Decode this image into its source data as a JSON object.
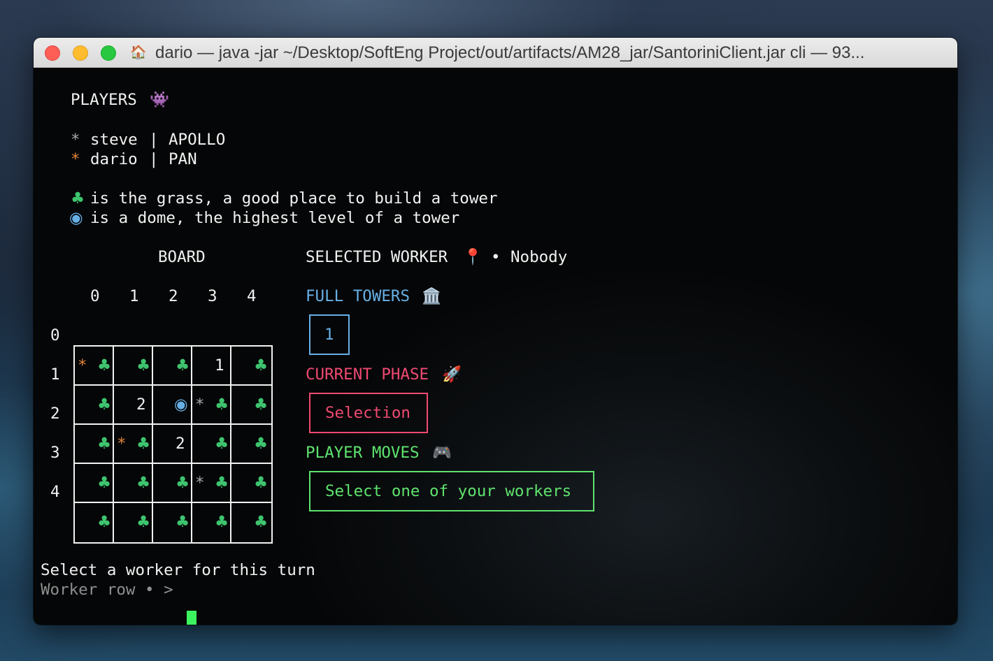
{
  "window": {
    "title": "dario — java -jar ~/Desktop/SoftEng Project/out/artifacts/AM28_jar/SantoriniClient.jar cli — 93...",
    "icon": "home-icon"
  },
  "players": {
    "heading": "PLAYERS",
    "heading_icon": "👾",
    "list": [
      {
        "marker": "*",
        "name": "steve",
        "sep": "|",
        "god": "APOLLO",
        "color": "#a9a9a9"
      },
      {
        "marker": "*",
        "name": "dario",
        "sep": "|",
        "god": "PAN",
        "color": "#e0843a"
      }
    ]
  },
  "legend": [
    {
      "symbol": "♣",
      "text": "is the grass, a good place to build a tower",
      "color": "#3ec46f"
    },
    {
      "symbol": "◉",
      "text": "is a dome, the highest level of a tower",
      "color": "#67b0e6"
    }
  ],
  "board": {
    "title": "BOARD",
    "col_headers": [
      "0",
      "1",
      "2",
      "3",
      "4"
    ],
    "row_headers": [
      "0",
      "1",
      "2",
      "3",
      "4"
    ],
    "rows": [
      [
        {
          "worker": "orange",
          "level": "",
          "dome": false,
          "grass": true
        },
        {
          "worker": "",
          "level": "",
          "dome": false,
          "grass": true
        },
        {
          "worker": "",
          "level": "",
          "dome": false,
          "grass": true
        },
        {
          "worker": "",
          "level": "1",
          "dome": false,
          "grass": false
        },
        {
          "worker": "",
          "level": "",
          "dome": false,
          "grass": true
        }
      ],
      [
        {
          "worker": "",
          "level": "",
          "dome": false,
          "grass": true
        },
        {
          "worker": "",
          "level": "2",
          "dome": false,
          "grass": false
        },
        {
          "worker": "",
          "level": "",
          "dome": true,
          "grass": false
        },
        {
          "worker": "grey",
          "level": "",
          "dome": false,
          "grass": true
        },
        {
          "worker": "",
          "level": "",
          "dome": false,
          "grass": true
        }
      ],
      [
        {
          "worker": "",
          "level": "",
          "dome": false,
          "grass": true
        },
        {
          "worker": "orange",
          "level": "",
          "dome": false,
          "grass": true
        },
        {
          "worker": "",
          "level": "2",
          "dome": false,
          "grass": false
        },
        {
          "worker": "",
          "level": "",
          "dome": false,
          "grass": true
        },
        {
          "worker": "",
          "level": "",
          "dome": false,
          "grass": true
        }
      ],
      [
        {
          "worker": "",
          "level": "",
          "dome": false,
          "grass": true
        },
        {
          "worker": "",
          "level": "",
          "dome": false,
          "grass": true
        },
        {
          "worker": "",
          "level": "",
          "dome": false,
          "grass": true
        },
        {
          "worker": "grey",
          "level": "",
          "dome": false,
          "grass": true
        },
        {
          "worker": "",
          "level": "",
          "dome": false,
          "grass": true
        }
      ],
      [
        {
          "worker": "",
          "level": "",
          "dome": false,
          "grass": true
        },
        {
          "worker": "",
          "level": "",
          "dome": false,
          "grass": true
        },
        {
          "worker": "",
          "level": "",
          "dome": false,
          "grass": true
        },
        {
          "worker": "",
          "level": "",
          "dome": false,
          "grass": true
        },
        {
          "worker": "",
          "level": "",
          "dome": false,
          "grass": true
        }
      ]
    ]
  },
  "selected_worker": {
    "label": "SELECTED WORKER",
    "icon": "📍",
    "bullet": "•",
    "value": "Nobody"
  },
  "full_towers": {
    "label": "FULL TOWERS",
    "icon": "🏛️",
    "value": "1"
  },
  "current_phase": {
    "label": "CURRENT PHASE",
    "icon": "🚀",
    "value": "Selection"
  },
  "player_moves": {
    "label": "PLAYER MOVES",
    "icon": "🎮",
    "value": "Select one of your workers"
  },
  "prompt": {
    "message": "Select a worker for this turn",
    "input_label": "Worker row • >"
  },
  "colors": {
    "grey_worker": "#a9a9a9",
    "orange_worker": "#e0843a",
    "grass": "#3ec46f",
    "dome": "#67b0e6",
    "full_towers": "#67b0e6",
    "current_phase": "#ef4a72",
    "player_moves": "#5fe36e",
    "cursor": "#3cf35f"
  }
}
